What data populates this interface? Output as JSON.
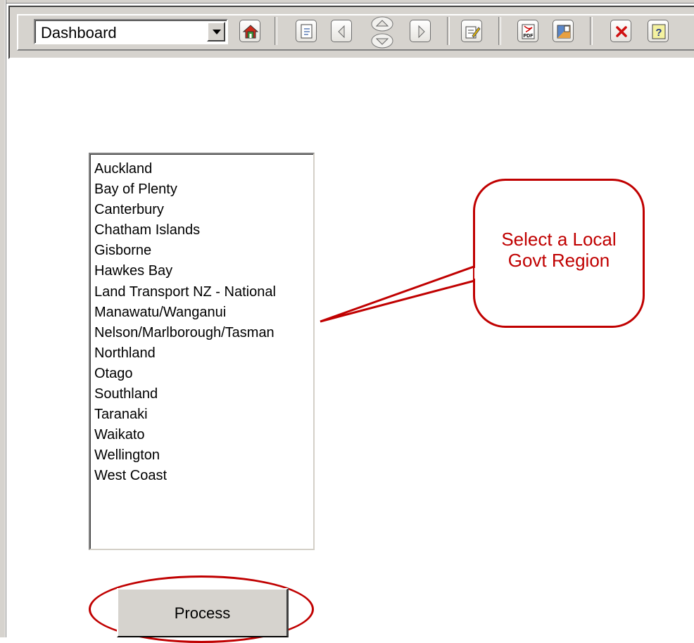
{
  "toolbar": {
    "report_selector_value": "Dashboard",
    "buttons": [
      {
        "name": "home-icon"
      },
      {
        "name": "page-number-icon"
      },
      {
        "name": "previous-page-icon"
      },
      {
        "name": "scroll-up-down-icon"
      },
      {
        "name": "next-page-icon"
      },
      {
        "name": "edit-icon"
      },
      {
        "name": "export-pdf-icon",
        "label": "PDF"
      },
      {
        "name": "export-image-icon"
      },
      {
        "name": "close-icon"
      },
      {
        "name": "help-icon",
        "label": "?"
      }
    ]
  },
  "region_list": {
    "items": [
      "Auckland",
      "Bay of Plenty",
      "Canterbury",
      "Chatham Islands",
      "Gisborne",
      "Hawkes Bay",
      "Land Transport NZ - National",
      "Manawatu/Wanganui",
      "Nelson/Marlborough/Tasman",
      "Northland",
      "Otago",
      "Southland",
      "Taranaki",
      "Waikato",
      "Wellington",
      "West Coast"
    ]
  },
  "callout": {
    "line1": "Select a Local",
    "line2": "Govt Region",
    "color": "#c00000"
  },
  "process_button": {
    "label": "Process"
  }
}
